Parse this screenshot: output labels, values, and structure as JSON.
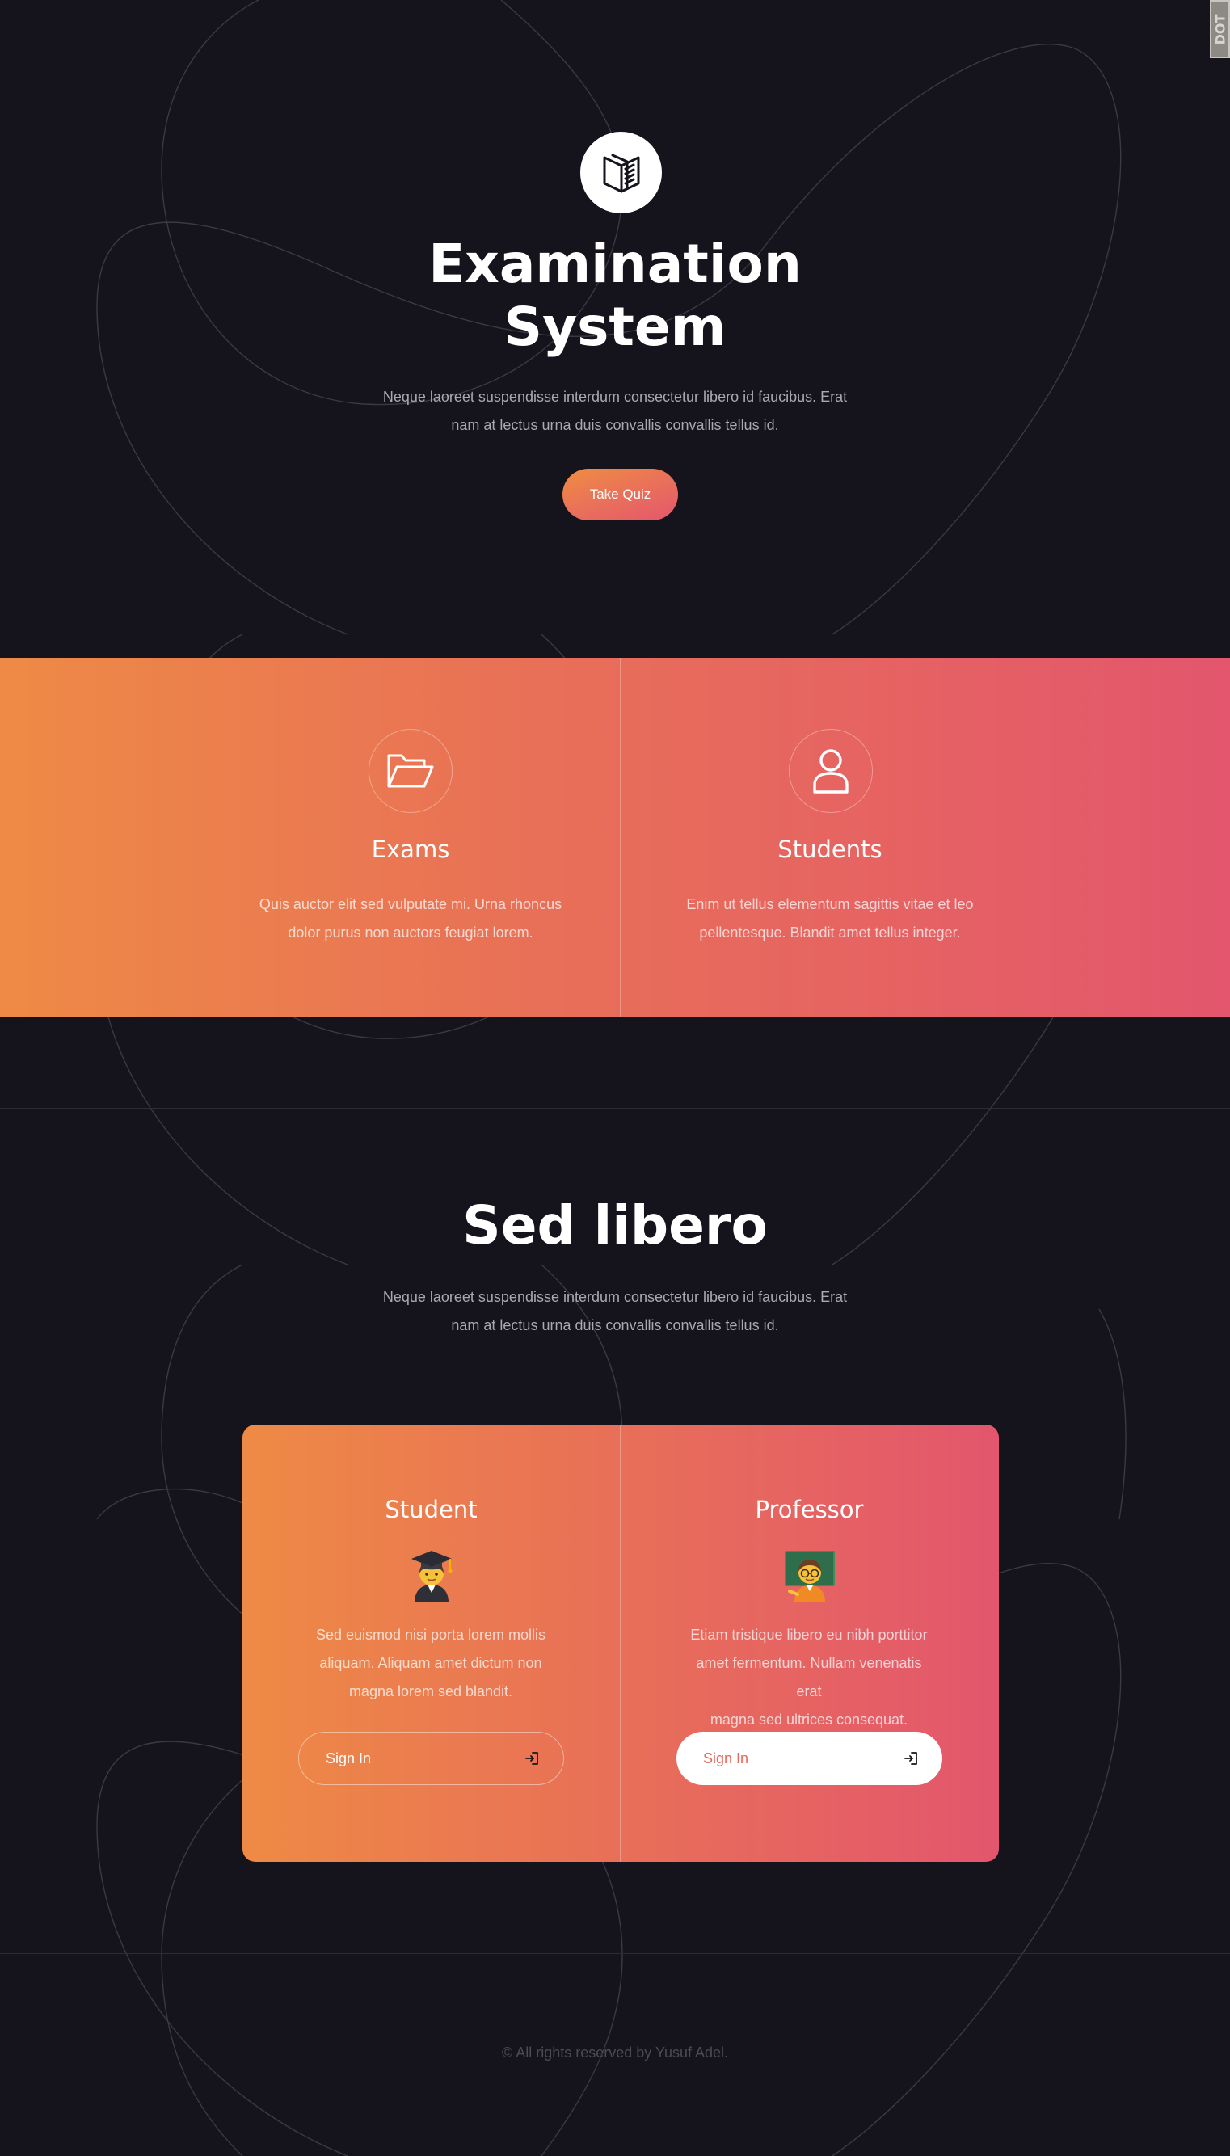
{
  "hero": {
    "title_line1": "Examination",
    "title_line2": "System",
    "text_line1": "Neque laoreet suspendisse interdum consectetur libero id faucibus. Erat",
    "text_line2": "nam at lectus urna duis convallis convallis tellus id.",
    "button_label": "Take Quiz",
    "logo_icon": "book-icon"
  },
  "features": [
    {
      "icon": "folder-open-icon",
      "title": "Exams",
      "text_line1": "Quis auctor elit sed vulputate mi. Urna rhoncus",
      "text_line2": "dolor purus non auctors feugiat lorem."
    },
    {
      "icon": "user-icon",
      "title": "Students",
      "text_line1": "Enim ut tellus elementum sagittis vitae et leo",
      "text_line2": "pellentesque. Blandit amet tellus integer."
    }
  ],
  "section2": {
    "title": "Sed libero",
    "text_line1": "Neque laoreet suspendisse interdum consectetur libero id faucibus. Erat",
    "text_line2": "nam at lectus urna duis convallis convallis tellus id."
  },
  "roles": [
    {
      "title": "Student",
      "emoji": "student-emoji",
      "text_line1": "Sed euismod nisi porta lorem mollis",
      "text_line2": "aliquam. Aliquam amet dictum non",
      "text_line3": "magna lorem sed blandit.",
      "button_label": "Sign In",
      "button_style": "outline"
    },
    {
      "title": "Professor",
      "emoji": "teacher-emoji",
      "text_line1": "Etiam tristique libero eu nibh porttitor",
      "text_line2": "amet fermentum. Nullam venenatis erat",
      "text_line3": "magna sed ultrices consequat.",
      "button_label": "Sign In",
      "button_style": "solid"
    }
  ],
  "footer": {
    "text": "© All rights reserved by Yusuf Adel."
  },
  "corner_badge": {
    "text": "DOT"
  },
  "colors": {
    "background": "#15141c",
    "gradient_start": "#ee8a45",
    "gradient_end": "#e3566d",
    "muted_text": "#a9a8b4",
    "footer_text": "#4b4a55"
  }
}
